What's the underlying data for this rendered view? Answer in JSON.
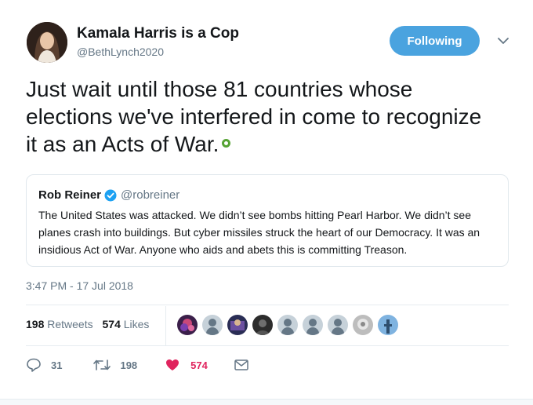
{
  "author": {
    "name": "Kamala Harris is a Cop",
    "handle": "@BethLynch2020"
  },
  "follow_label": "Following",
  "tweet_text": "Just wait until those 81 countries whose elections we've interfered in come to recognize it as an Acts of War.",
  "quote": {
    "name": "Rob Reiner",
    "handle": "@robreiner",
    "text": "The United States was attacked. We didn’t see bombs hitting Pearl Harbor. We didn’t see planes crash into buildings. But cyber missiles struck the heart of our Democracy. It was an insidious Act of War. Anyone who aids and abets this is committing Treason."
  },
  "timestamp": "3:47 PM - 17 Jul 2018",
  "stats": {
    "retweets": "198",
    "retweets_label": "Retweets",
    "likes": "574",
    "likes_label": "Likes"
  },
  "actions": {
    "replies": "31",
    "retweets": "198",
    "likes": "574"
  },
  "colors": {
    "accent": "#4aa3df",
    "like": "#e0245e",
    "muted": "#657786",
    "verified": "#1da1f2"
  }
}
